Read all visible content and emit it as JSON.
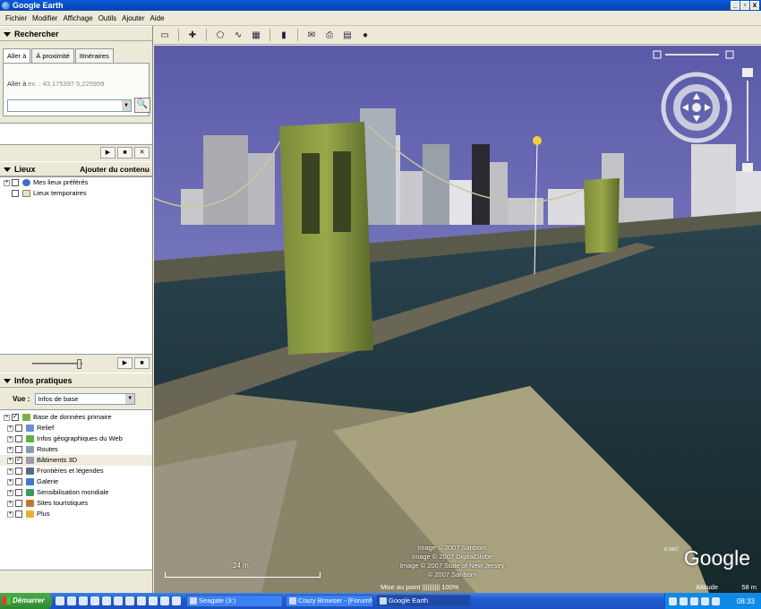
{
  "window": {
    "title": "Google Earth",
    "buttons": [
      "_",
      "▫",
      "x"
    ]
  },
  "menu": [
    "Fichier",
    "Modifier",
    "Affichage",
    "Outils",
    "Ajouter",
    "Aide"
  ],
  "search_panel": {
    "title": "Rechercher",
    "tabs": [
      "Aller à",
      "À proximité",
      "Itinéraires"
    ],
    "goto_label": "Aller à",
    "goto_placeholder": "ex. : 43,175397 5,225959",
    "controls": [
      "▶",
      "■",
      "✕"
    ]
  },
  "places_panel": {
    "title": "Lieux",
    "add_content": "Ajouter du contenu",
    "items": [
      {
        "label": "Mes lieux préférés",
        "icon": "globe-icon"
      },
      {
        "label": "Lieux temporaires",
        "icon": "folder-icon"
      }
    ],
    "controls": [
      "▶",
      "■"
    ]
  },
  "layers_panel": {
    "title": "Infos pratiques",
    "view_label": "Vue :",
    "view_value": "Infos de base",
    "items": [
      {
        "label": "Base de données primaire",
        "checked": true,
        "color": "#7fb04a",
        "level": 0
      },
      {
        "label": "Relief",
        "checked": false,
        "color": "#6a8fd0",
        "level": 1
      },
      {
        "label": "Infos géographiques du Web",
        "checked": false,
        "color": "#5ab24a",
        "level": 1
      },
      {
        "label": "Routes",
        "checked": false,
        "color": "#8a9ab0",
        "level": 1
      },
      {
        "label": "Bâtiments 3D",
        "checked": true,
        "color": "#9a9aa8",
        "level": 1
      },
      {
        "label": "Frontières et légendes",
        "checked": false,
        "color": "#5a6a8a",
        "level": 1
      },
      {
        "label": "Galerie",
        "checked": false,
        "color": "#3a7ad0",
        "level": 1
      },
      {
        "label": "Sensibilisation mondiale",
        "checked": false,
        "color": "#3a9a5a",
        "level": 1
      },
      {
        "label": "Sites touristiques",
        "checked": false,
        "color": "#c07a30",
        "level": 1
      },
      {
        "label": "Plus",
        "checked": false,
        "color": "#e8b030",
        "level": 1
      }
    ]
  },
  "map": {
    "credits": [
      "Image © 2007 Sanborn",
      "Image © 2007 DigitalGlobe",
      "Image © 2007 State of New Jersey",
      "© 2007 Sanborn"
    ],
    "logo": "Google",
    "logo_copyright": "© 2007",
    "scale_label": "24 m",
    "streaming": "Mise au point |||||||||| 100%",
    "altitude_label": "Altitude",
    "altitude_value": "58 m"
  },
  "taskbar": {
    "start": "Démarrer",
    "tasks": [
      "Seagate (3:)",
      "Crazy Browser - [ForumN...",
      "Google Earth"
    ],
    "clock": "08:33"
  }
}
